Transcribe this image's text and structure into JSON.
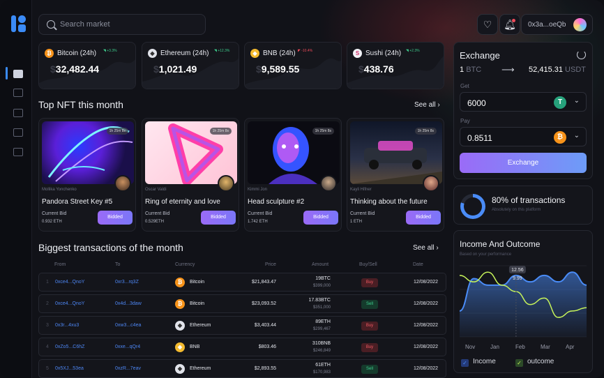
{
  "search": {
    "placeholder": "Search market"
  },
  "wallet": {
    "address": "0x3a...oeQb"
  },
  "tickers": [
    {
      "name": "Bitcoin (24h)",
      "change": "+3.3%",
      "dir": "up",
      "value": "32,482.44",
      "icon": "bitcoin-icon",
      "symbol": "₿",
      "color": "#f7931a"
    },
    {
      "name": "Ethereum (24h)",
      "change": "+12.3%",
      "dir": "up",
      "value": "1,021.49",
      "icon": "ethereum-icon",
      "symbol": "◆",
      "color": "#c9ccd5"
    },
    {
      "name": "BNB (24h)",
      "change": "-10.4%",
      "dir": "down",
      "value": "9,589.55",
      "icon": "bnb-icon",
      "symbol": "◆",
      "color": "#f3ba2f"
    },
    {
      "name": "Sushi (24h)",
      "change": "+2.3%",
      "dir": "up",
      "value": "438.76",
      "icon": "sushi-icon",
      "symbol": "S",
      "color": "#e8e8f0"
    }
  ],
  "nft_section": {
    "title": "Top NFT this month",
    "see_all": "See all"
  },
  "nfts": [
    {
      "time": "1h 25m 8s",
      "author": "Mollika Yonchenko",
      "title": "Pandora Street Key #5",
      "bid_label": "Current Bid",
      "bid": "0.932 ETH",
      "button": "Bidded"
    },
    {
      "time": "1h 25m 8s",
      "author": "Oscar Valdi",
      "title": "Ring of eternity and love",
      "bid_label": "Current Bid",
      "bid": "0.529ETH",
      "button": "Bidded"
    },
    {
      "time": "1h 25m 8s",
      "author": "Kimmi Jon",
      "title": "Head sculpture #2",
      "bid_label": "Current Bid",
      "bid": "1.742 ETH",
      "button": "Bidded"
    },
    {
      "time": "1h 25m 8s",
      "author": "Kayli Hifner",
      "title": "Thinking about the future",
      "bid_label": "Current Bid",
      "bid": "1 ETH",
      "button": "Bidded"
    }
  ],
  "tx_section": {
    "title": "Biggest transactions of the month",
    "see_all": "See all"
  },
  "tx_headers": {
    "from": "From",
    "to": "To",
    "currency": "Currency",
    "price": "Price",
    "amount": "Amount",
    "buysell": "Buy/Sell",
    "date": "Date"
  },
  "transactions": [
    {
      "idx": "1",
      "from": "0xce4...QnoY",
      "to": "0xr3...rq3Z",
      "currency": "Bitcoin",
      "cur_icon": "bitcoin-icon",
      "price": "$21,843.47",
      "amount": "19BTC",
      "amount_usd": "$399,000",
      "side": "Buy",
      "date": "12/08/2022"
    },
    {
      "idx": "2",
      "from": "0xce4...QnoY",
      "to": "0x4d...3daw",
      "currency": "Bitcoin",
      "cur_icon": "bitcoin-icon",
      "price": "$23,093.52",
      "amount": "17.83BTC",
      "amount_usd": "$351,000",
      "side": "Sell",
      "date": "12/08/2022"
    },
    {
      "idx": "3",
      "from": "0x3r...4xu3",
      "to": "0xw3...c4ea",
      "currency": "Ethereum",
      "cur_icon": "ethereum-icon",
      "price": "$3,403.44",
      "amount": "89ETH",
      "amount_usd": "$299,467",
      "side": "Buy",
      "date": "12/08/2022"
    },
    {
      "idx": "4",
      "from": "0xZo5...C6hZ",
      "to": "0xxe...qQr4",
      "currency": "BNB",
      "cur_icon": "bnb-icon",
      "price": "$803.46",
      "amount": "310BNB",
      "amount_usd": "$246,849",
      "side": "Buy",
      "date": "12/08/2022"
    },
    {
      "idx": "5",
      "from": "0x5XJ...53ea",
      "to": "0xzR...7eav",
      "currency": "Ethereum",
      "cur_icon": "ethereum-icon",
      "price": "$2,893.55",
      "amount": "61ETH",
      "amount_usd": "$170,983",
      "side": "Sell",
      "date": "12/08/2022"
    }
  ],
  "exchange": {
    "title": "Exchange",
    "from_amount": "1",
    "from_unit": "BTC",
    "to_amount": "52,415.31",
    "to_unit": "USDT",
    "get_label": "Get",
    "get_value": "6000",
    "pay_label": "Pay",
    "pay_value": "0.8511",
    "button": "Exchange"
  },
  "transactions_stat": {
    "percent": 80,
    "text": "80% of transactions",
    "sub": "Absolutely on this platform"
  },
  "income": {
    "title": "Income And Outcome",
    "sub": "Based on your performance",
    "legend_income": "Income",
    "legend_outcome": "outcome"
  },
  "chart_data": {
    "type": "line",
    "title": "Income And Outcome",
    "categories": [
      "Nov",
      "Jan",
      "Feb",
      "Mar",
      "Apr"
    ],
    "series": [
      {
        "name": "Income",
        "color": "#4a8cf7",
        "values": [
          8,
          18,
          16,
          16,
          19,
          17,
          19,
          17,
          20,
          16
        ]
      },
      {
        "name": "outcome",
        "color": "#c7f45a",
        "values": [
          19,
          17,
          20,
          16,
          14,
          10,
          12,
          6,
          8,
          9
        ]
      }
    ],
    "annotations": [
      "12.56",
      "9.99"
    ]
  }
}
